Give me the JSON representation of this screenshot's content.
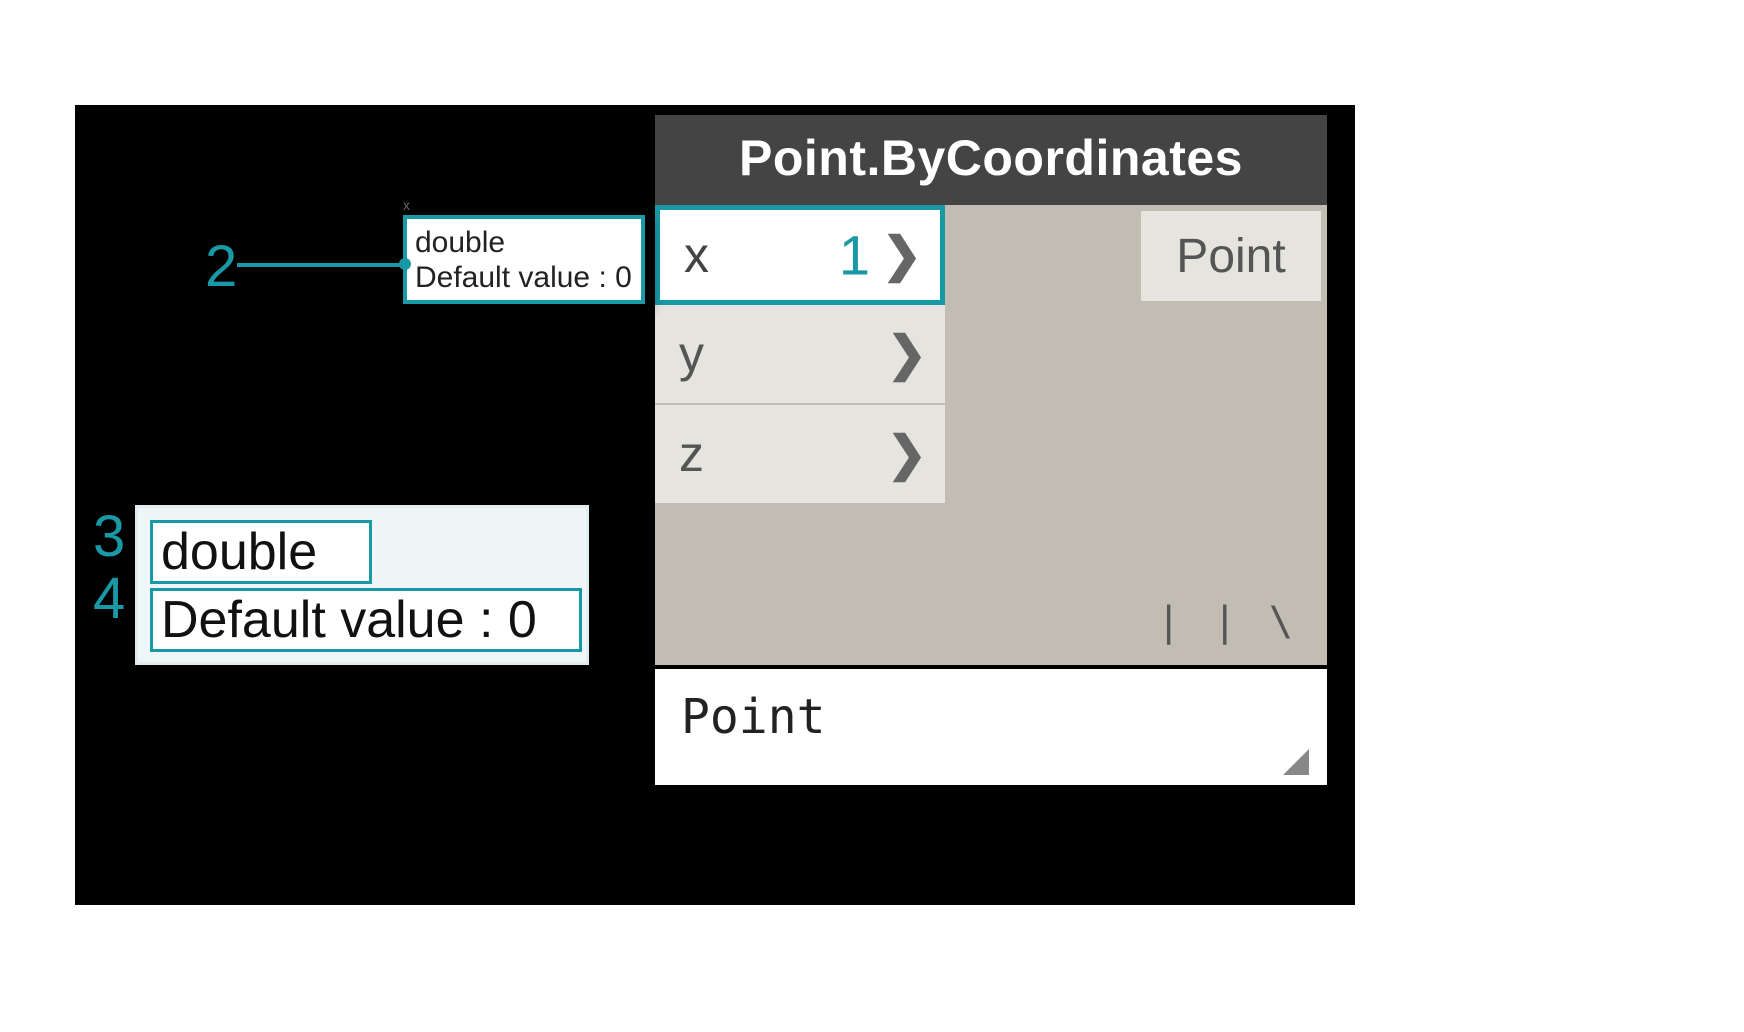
{
  "node": {
    "title": "Point.ByCoordinates",
    "inputs": [
      {
        "label": "x",
        "active": true
      },
      {
        "label": "y",
        "active": false
      },
      {
        "label": "z",
        "active": false
      }
    ],
    "output": {
      "label": "Point"
    },
    "lacing_glyph": "| | \\",
    "preview_text": "Point"
  },
  "tooltip": {
    "type": "double",
    "default_text": "Default value : 0"
  },
  "enlarged_tooltip": {
    "type": "double",
    "default_text": "Default value : 0"
  },
  "callouts": {
    "c1": "1",
    "c2": "2",
    "c3": "3",
    "c4": "4"
  },
  "colors": {
    "accent": "#1998a6",
    "node_header_bg": "#444444",
    "node_body_bg": "#c1bdb3",
    "port_idle_bg": "#e6e4de"
  }
}
